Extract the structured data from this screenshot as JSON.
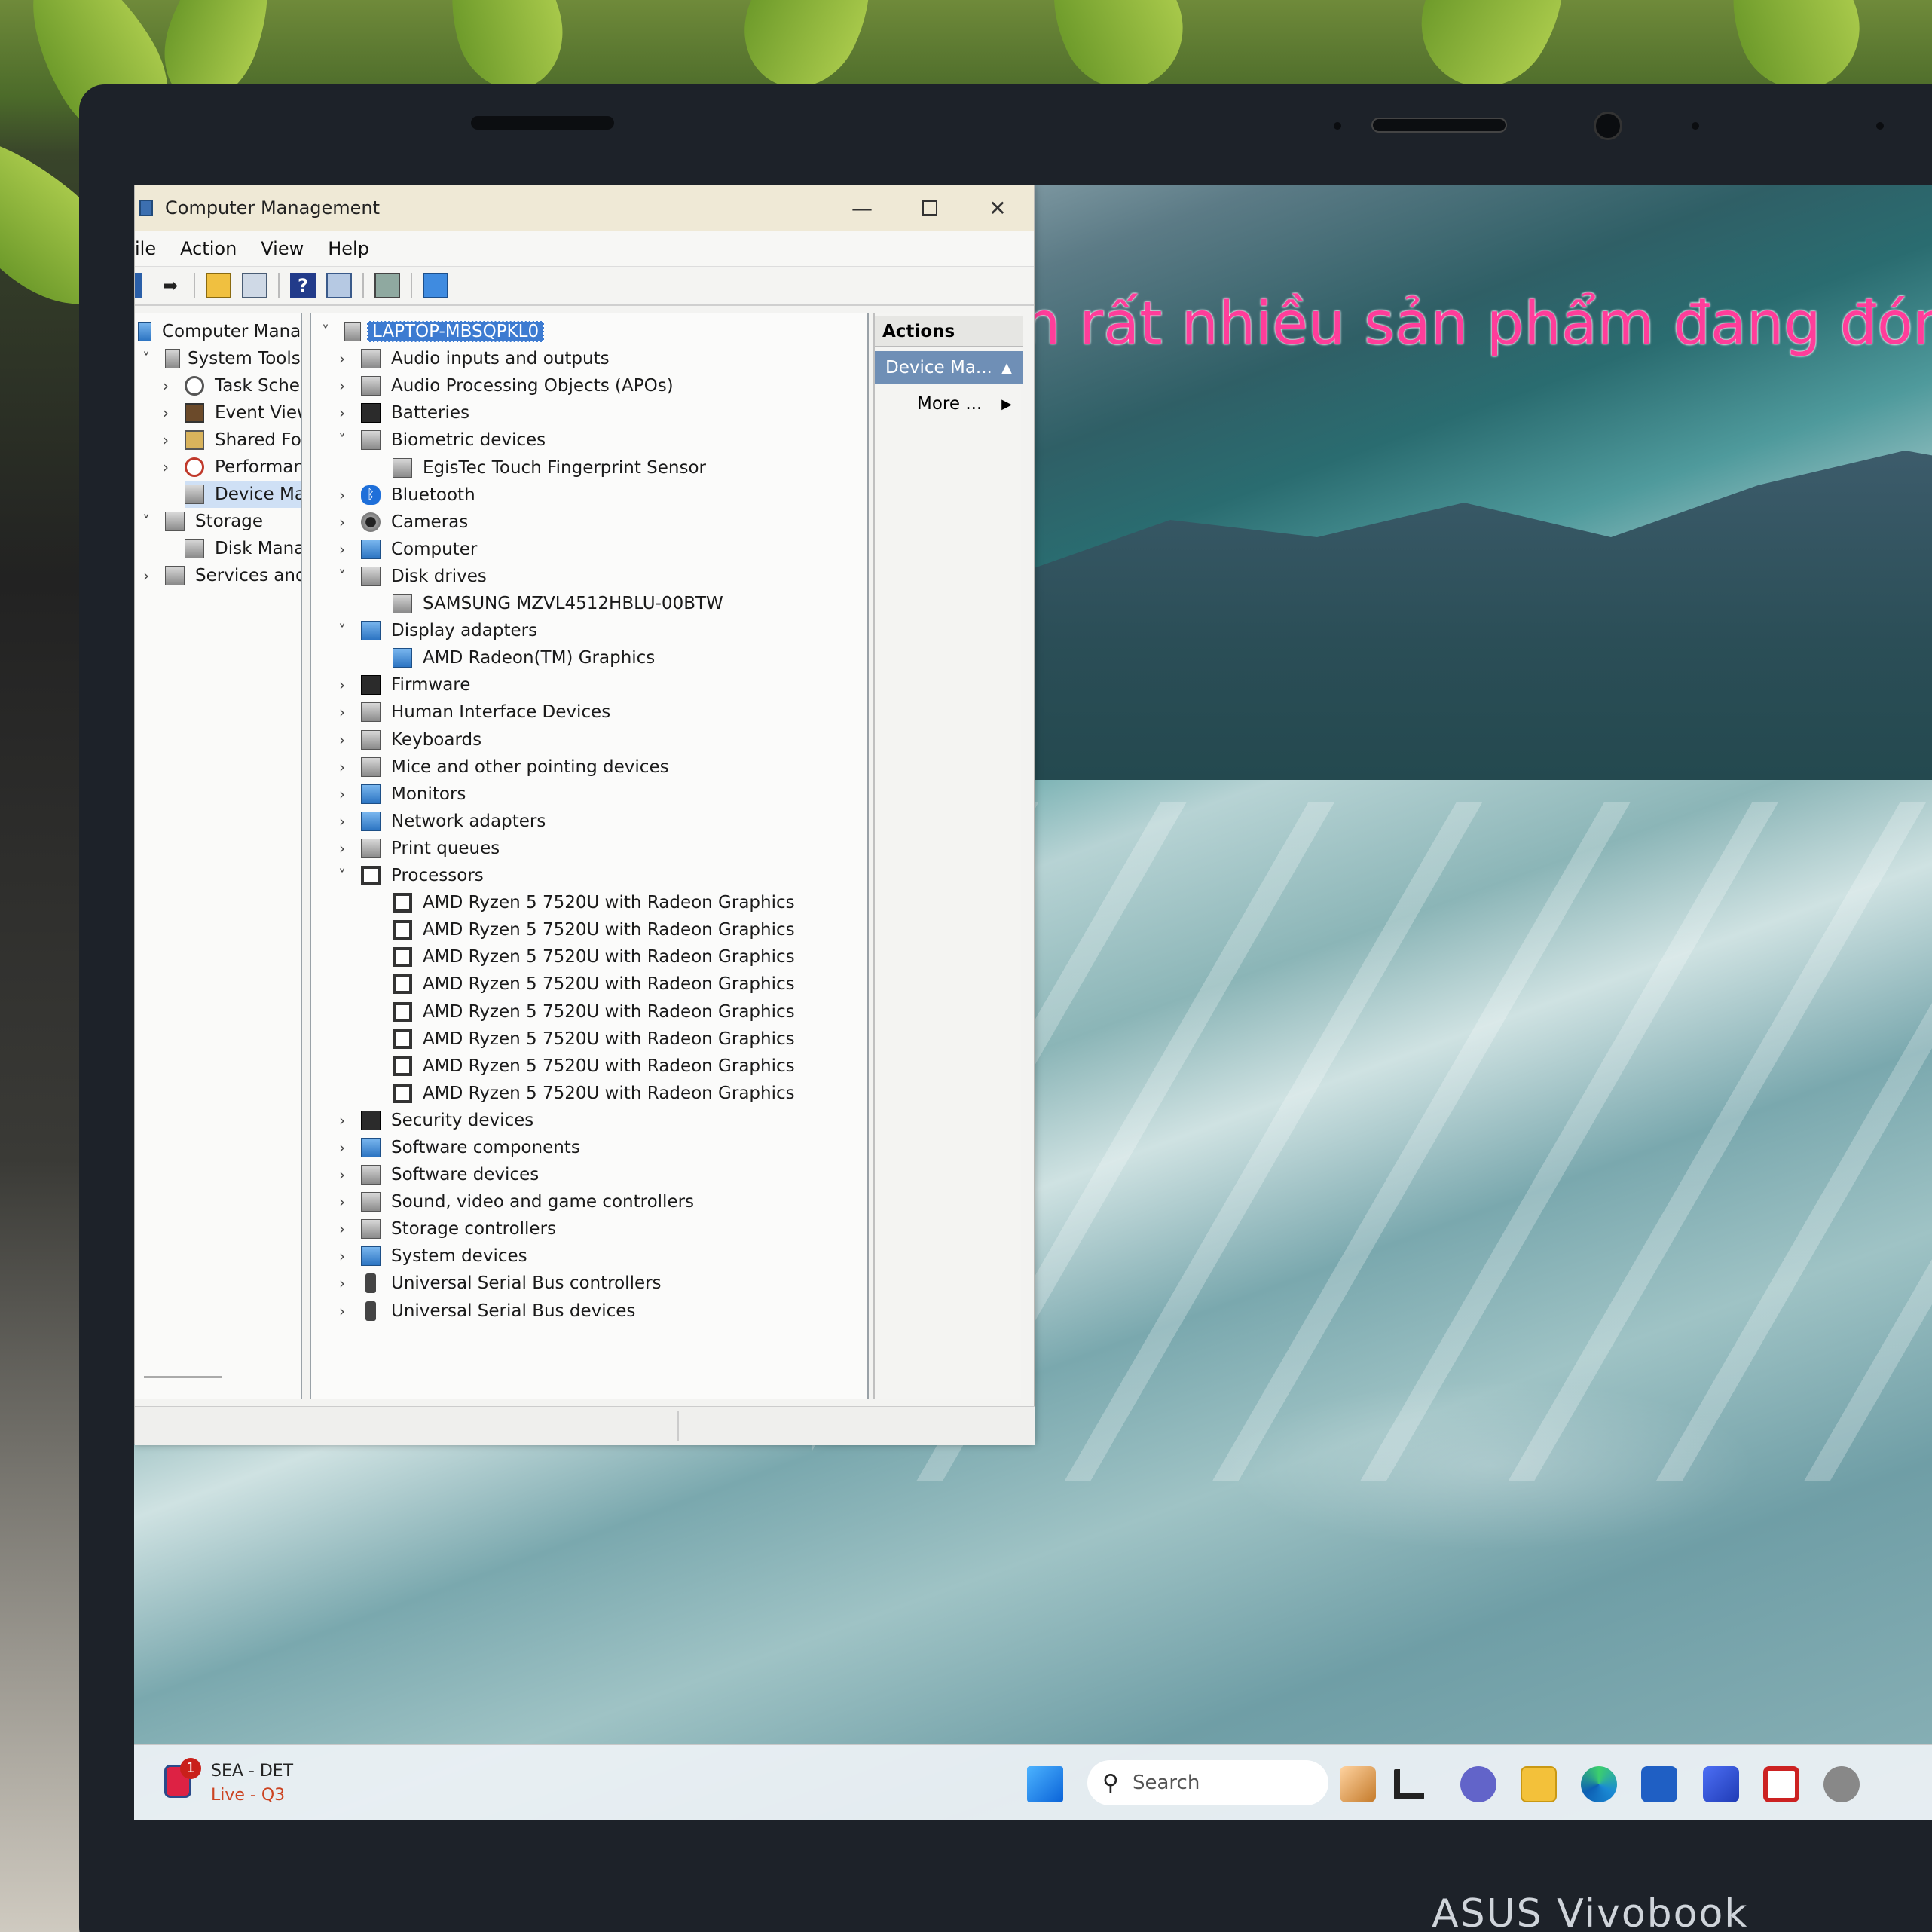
{
  "window": {
    "title": "Computer Management",
    "menu": [
      "ile",
      "Action",
      "View",
      "Help"
    ]
  },
  "left_tree": [
    {
      "label": "Computer Manag",
      "indent": 0
    },
    {
      "label": "System Tools",
      "indent": 1
    },
    {
      "label": "Task Sched",
      "indent": 2
    },
    {
      "label": "Event View",
      "indent": 2
    },
    {
      "label": "Shared Fol",
      "indent": 2
    },
    {
      "label": "Performan",
      "indent": 2
    },
    {
      "label": "Device Mar",
      "indent": 2,
      "selected": true
    },
    {
      "label": "Storage",
      "indent": 1
    },
    {
      "label": "Disk Manag",
      "indent": 2
    },
    {
      "label": "Services and A",
      "indent": 1
    }
  ],
  "device_tree": {
    "root": "LAPTOP-MBSQPKL0",
    "items": [
      {
        "label": "Audio inputs and outputs",
        "expanded": false,
        "icon": "speaker-icon"
      },
      {
        "label": "Audio Processing Objects (APOs)",
        "expanded": false,
        "icon": "speaker-icon"
      },
      {
        "label": "Batteries",
        "expanded": false,
        "icon": "battery-icon"
      },
      {
        "label": "Biometric devices",
        "expanded": true,
        "icon": "biometric-icon",
        "children": [
          "EgisTec Touch Fingerprint Sensor"
        ]
      },
      {
        "label": "Bluetooth",
        "expanded": false,
        "icon": "bluetooth-icon"
      },
      {
        "label": "Cameras",
        "expanded": false,
        "icon": "camera-icon"
      },
      {
        "label": "Computer",
        "expanded": false,
        "icon": "computer-icon"
      },
      {
        "label": "Disk drives",
        "expanded": true,
        "icon": "disk-icon",
        "children": [
          "SAMSUNG MZVL4512HBLU-00BTW"
        ]
      },
      {
        "label": "Display adapters",
        "expanded": true,
        "icon": "display-icon",
        "children": [
          "AMD Radeon(TM) Graphics"
        ]
      },
      {
        "label": "Firmware",
        "expanded": false,
        "icon": "firmware-icon"
      },
      {
        "label": "Human Interface Devices",
        "expanded": false,
        "icon": "hid-icon"
      },
      {
        "label": "Keyboards",
        "expanded": false,
        "icon": "keyboard-icon"
      },
      {
        "label": "Mice and other pointing devices",
        "expanded": false,
        "icon": "mouse-icon"
      },
      {
        "label": "Monitors",
        "expanded": false,
        "icon": "monitor-icon"
      },
      {
        "label": "Network adapters",
        "expanded": false,
        "icon": "network-icon"
      },
      {
        "label": "Print queues",
        "expanded": false,
        "icon": "printer-icon"
      },
      {
        "label": "Processors",
        "expanded": true,
        "icon": "processor-icon",
        "children": [
          "AMD Ryzen 5 7520U with Radeon Graphics",
          "AMD Ryzen 5 7520U with Radeon Graphics",
          "AMD Ryzen 5 7520U with Radeon Graphics",
          "AMD Ryzen 5 7520U with Radeon Graphics",
          "AMD Ryzen 5 7520U with Radeon Graphics",
          "AMD Ryzen 5 7520U with Radeon Graphics",
          "AMD Ryzen 5 7520U with Radeon Graphics",
          "AMD Ryzen 5 7520U with Radeon Graphics"
        ]
      },
      {
        "label": "Security devices",
        "expanded": false,
        "icon": "security-icon"
      },
      {
        "label": "Software components",
        "expanded": false,
        "icon": "software-component-icon"
      },
      {
        "label": "Software devices",
        "expanded": false,
        "icon": "software-device-icon"
      },
      {
        "label": "Sound, video and game controllers",
        "expanded": false,
        "icon": "sound-icon"
      },
      {
        "label": "Storage controllers",
        "expanded": false,
        "icon": "storage-controller-icon"
      },
      {
        "label": "System devices",
        "expanded": false,
        "icon": "system-device-icon"
      },
      {
        "label": "Universal Serial Bus controllers",
        "expanded": false,
        "icon": "usb-icon"
      },
      {
        "label": "Universal Serial Bus devices",
        "expanded": false,
        "icon": "usb-icon"
      }
    ]
  },
  "actions_pane": {
    "header": "Actions",
    "section": "Device Ma...",
    "more": "More ..."
  },
  "desktop": {
    "caption": "n rất nhiều sản phẩm đang đón"
  },
  "taskbar": {
    "widget_line1": "SEA - DET",
    "widget_line2": "Live - Q3",
    "widget_badge": "1",
    "search_label": "Search"
  },
  "laptop_brand": "ASUS Vivobook"
}
